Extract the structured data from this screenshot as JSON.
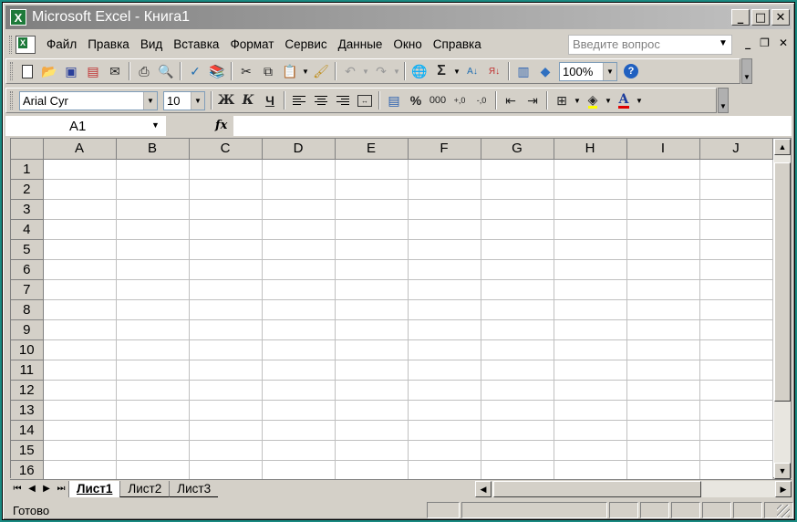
{
  "window": {
    "title": "Microsoft Excel - Книга1",
    "app_icon": "excel-icon",
    "controls": [
      "minimize-icon",
      "maximize-icon",
      "close-icon"
    ]
  },
  "menu": {
    "items": [
      "Файл",
      "Правка",
      "Вид",
      "Вставка",
      "Формат",
      "Сервис",
      "Данные",
      "Окно",
      "Справка"
    ],
    "help_placeholder": "Введите вопрос"
  },
  "standard_toolbar": {
    "zoom": "100%",
    "icons": [
      "new-icon",
      "open-icon",
      "save-icon",
      "permission-icon",
      "email-icon",
      "print-icon",
      "print-preview-icon",
      "spelling-icon",
      "research-icon",
      "cut-icon",
      "copy-icon",
      "paste-icon",
      "format-painter-icon",
      "undo-icon",
      "redo-icon",
      "hyperlink-icon",
      "autosum-icon",
      "sort-ascending-icon",
      "sort-descending-icon",
      "chart-wizard-icon",
      "drawing-icon",
      "help-icon"
    ]
  },
  "formatting_toolbar": {
    "font_name": "Arial Cyr",
    "font_size": "10",
    "bold_label": "Ж",
    "italic_label": "К",
    "underline_label": "Ч",
    "percent_label": "%",
    "thousands_label": "000",
    "autosum_label": "Σ",
    "font_color_label": "А"
  },
  "formula_bar": {
    "name_box": "A1",
    "fx_label": "fx",
    "formula": ""
  },
  "grid": {
    "columns": [
      "A",
      "B",
      "C",
      "D",
      "E",
      "F",
      "G",
      "H",
      "I",
      "J"
    ],
    "rows": [
      "1",
      "2",
      "3",
      "4",
      "5",
      "6",
      "7",
      "8",
      "9",
      "10",
      "11",
      "12",
      "13",
      "14",
      "15",
      "16"
    ]
  },
  "sheets": {
    "tabs": [
      "Лист1",
      "Лист2",
      "Лист3"
    ],
    "active": "Лист1"
  },
  "status": {
    "text": "Готово"
  },
  "colors": {
    "desktop": "#1a8a82",
    "chrome": "#d4d0c8",
    "excel_green": "#1d7a3a"
  }
}
